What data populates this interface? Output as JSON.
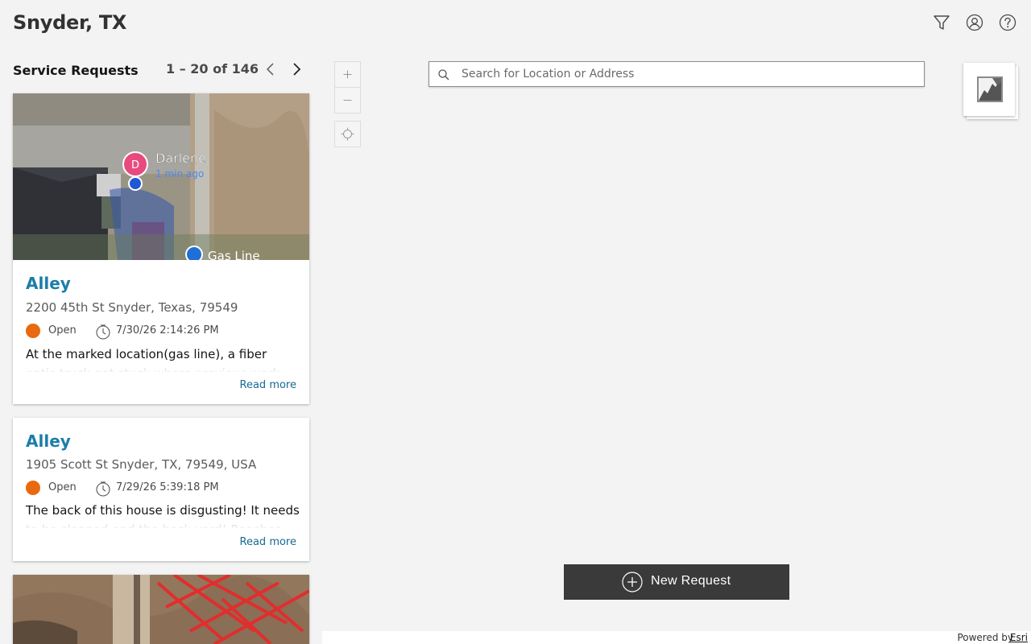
{
  "app": {
    "title": "Snyder, TX"
  },
  "header_icons": {
    "filter": "filter-icon",
    "account": "user-icon",
    "help": "question-icon"
  },
  "list": {
    "title": "Service Requests",
    "pager_text": "1 –  20 of 146"
  },
  "cards": [
    {
      "image_labels": {
        "name": "Darlene",
        "time": "1 min ago",
        "initial": "D",
        "place": "Gas Line"
      },
      "title": "Alley",
      "address": "2200 45th St Snyder, Texas, 79549",
      "status": "Open",
      "date": "7/30/26 2:14:26 PM",
      "description": "At the marked location(gas line), a fiber optic truck got stuck where previous work was",
      "read_more": "Read more"
    },
    {
      "title": "Alley",
      "address": "1905 Scott St Snyder, TX, 79549, USA",
      "status": "Open",
      "date": "7/29/26 5:39:18 PM",
      "description": "The back of this house is disgusting! It needs to be cleaned and the back yard! Roaches and",
      "read_more": "Read more"
    }
  ],
  "colors": {
    "status_open": "#e8690f",
    "title_link": "#1a7ea8",
    "button_dark": "#3a3a3a"
  },
  "map": {
    "search_placeholder": "Search for Location or Address",
    "new_request_label": "New Request",
    "attribution_text": "Powered by",
    "attribution_link": "Esri"
  }
}
